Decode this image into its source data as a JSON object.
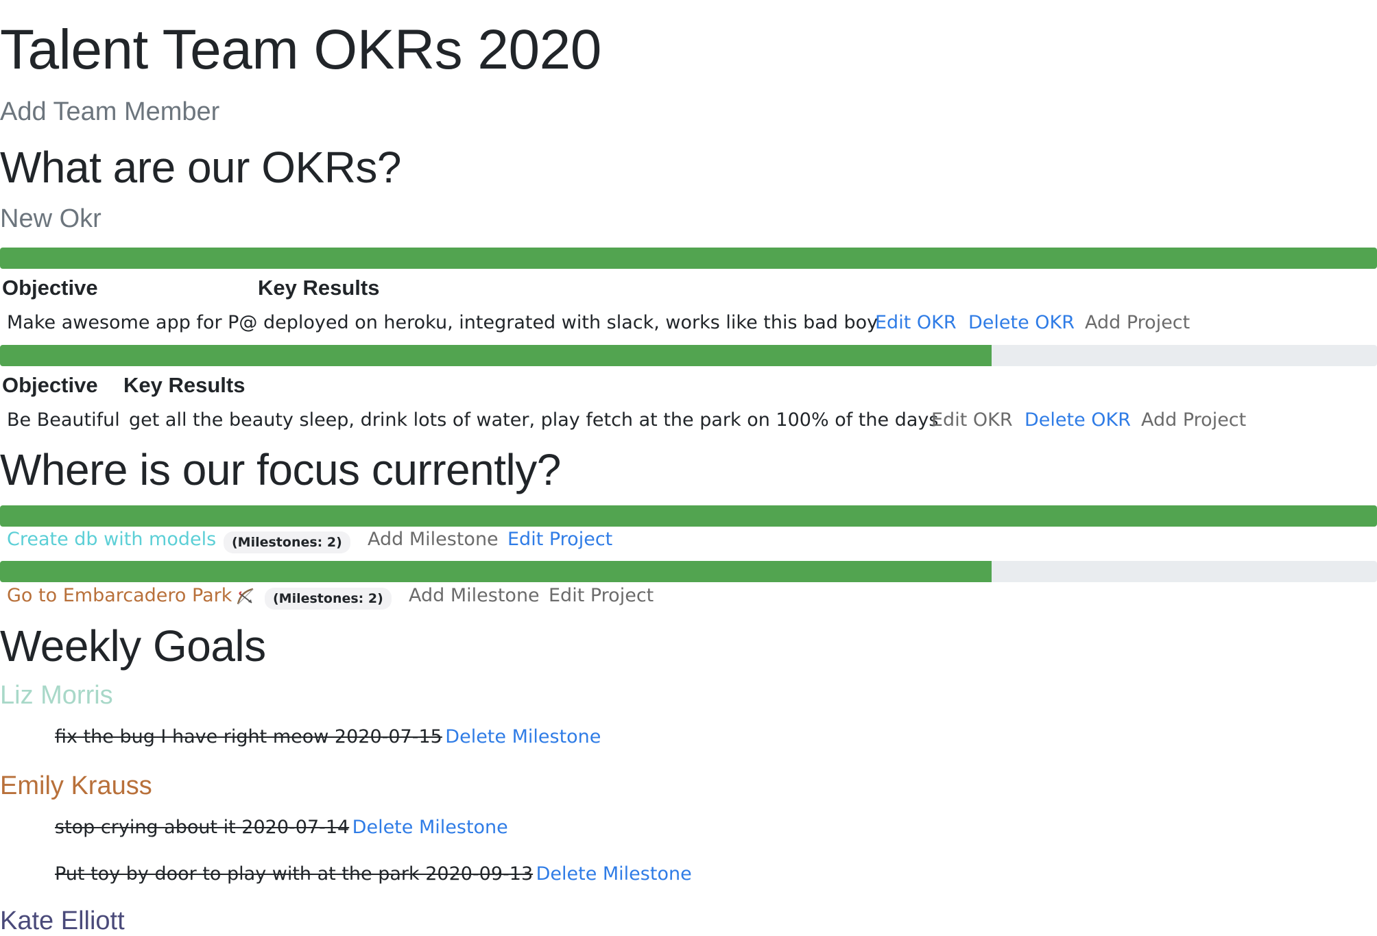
{
  "page": {
    "title": "Talent Team OKRs 2020",
    "add_team_member": "Add Team Member"
  },
  "okr_section": {
    "heading": "What are our OKRs?",
    "new_okr": "New Okr",
    "okrs": [
      {
        "progress": 1.0,
        "objective_header": "Objective",
        "key_results_header": "Key Results",
        "objective": "Make awesome app for P@",
        "key_results": "deployed on heroku, integrated with slack, works like this bad boy",
        "edit": "Edit OKR",
        "delete": "Delete OKR",
        "add_project": "Add Project"
      },
      {
        "progress": 0.72,
        "objective_header": "Objective",
        "key_results_header": "Key Results",
        "objective": "Be Beautiful",
        "key_results": "get all the beauty sleep, drink lots of water, play fetch at the park on 100% of the days",
        "edit": "Edit OKR",
        "delete": "Delete OKR",
        "add_project": "Add Project"
      }
    ]
  },
  "focus_section": {
    "heading": "Where is our focus currently?",
    "projects": [
      {
        "progress": 1.0,
        "name": "Create db with models",
        "color": "#5ccfd6",
        "milestones_badge": "(Milestones: 2)",
        "add_milestone": "Add Milestone",
        "edit_project": "Edit Project"
      },
      {
        "progress": 0.72,
        "name": "Go to Embarcadero Park",
        "color": "#b8703a",
        "icon": "bow-and-arrow-icon",
        "milestones_badge": "(Milestones: 2)",
        "add_milestone": "Add Milestone",
        "edit_project": "Edit Project"
      }
    ]
  },
  "weekly_section": {
    "heading": "Weekly Goals",
    "members": [
      {
        "name": "Liz Morris",
        "color": "#a8d8c8",
        "milestones": [
          {
            "text": "fix the bug I have right meow 2020-07-15",
            "delete": "Delete Milestone"
          }
        ]
      },
      {
        "name": "Emily Krauss",
        "color": "#b8703a",
        "milestones": [
          {
            "text": "stop crying about it 2020-07-14",
            "delete": "Delete Milestone"
          },
          {
            "text": "Put toy by door to play with at the park 2020-09-13",
            "delete": "Delete Milestone"
          }
        ]
      },
      {
        "name": "Kate Elliott",
        "color": "#4a4a7a",
        "milestones": []
      }
    ]
  }
}
